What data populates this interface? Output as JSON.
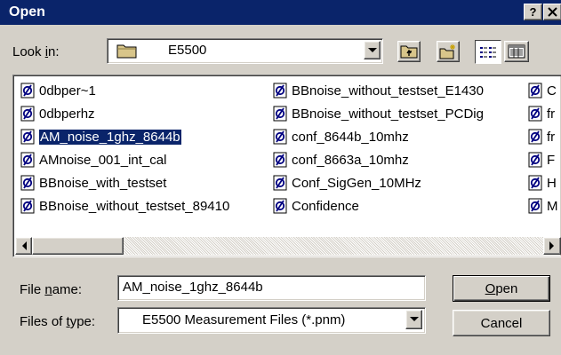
{
  "window": {
    "title": "Open"
  },
  "look_in": {
    "label_pre": "Look ",
    "label_ul": "i",
    "label_post": "n:",
    "value": "E5500"
  },
  "files": [
    {
      "name": "0dbper~1",
      "selected": false
    },
    {
      "name": "0dbperhz",
      "selected": false
    },
    {
      "name": "AM_noise_1ghz_8644b",
      "selected": true
    },
    {
      "name": "AMnoise_001_int_cal",
      "selected": false
    },
    {
      "name": "BBnoise_with_testset",
      "selected": false
    },
    {
      "name": "BBnoise_without_testset_89410",
      "selected": false
    },
    {
      "name": "BBnoise_without_testset_E1430",
      "selected": false
    },
    {
      "name": "BBnoise_without_testset_PCDig",
      "selected": false
    },
    {
      "name": "conf_8644b_10mhz",
      "selected": false
    },
    {
      "name": "conf_8663a_10mhz",
      "selected": false
    },
    {
      "name": "Conf_SigGen_10MHz",
      "selected": false
    },
    {
      "name": "Confidence",
      "selected": false
    },
    {
      "name": "C",
      "selected": false
    },
    {
      "name": "fr",
      "selected": false
    },
    {
      "name": "fr",
      "selected": false
    },
    {
      "name": "F",
      "selected": false
    },
    {
      "name": "H",
      "selected": false
    },
    {
      "name": "M",
      "selected": false
    }
  ],
  "file_name": {
    "label_pre": "File ",
    "label_ul": "n",
    "label_post": "ame:",
    "value": "AM_noise_1ghz_8644b"
  },
  "file_type": {
    "label_pre": "Files of ",
    "label_ul": "t",
    "label_post": "ype:",
    "value": "E5500 Measurement Files (*.pnm)"
  },
  "buttons": {
    "open_ul": "O",
    "open_rest": "pen",
    "cancel": "Cancel",
    "help": "?",
    "close": "X"
  },
  "icons": {
    "folder": "folder-icon",
    "up": "up-one-level-icon",
    "new_folder": "create-new-folder-icon",
    "list": "list-view-icon",
    "details": "details-view-icon",
    "file": "pnm-file-icon",
    "dropdown": "dropdown-arrow-icon"
  },
  "colors": {
    "title_bar": "#0a246a",
    "face": "#d4d0c8",
    "selection": "#0a246a"
  }
}
